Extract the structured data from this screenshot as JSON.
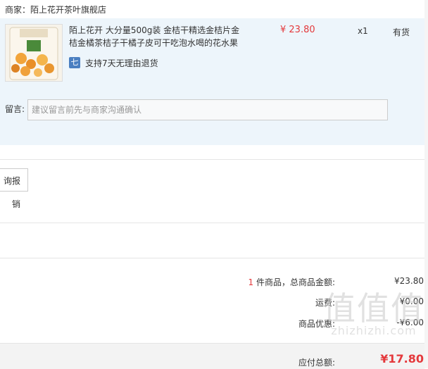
{
  "seller": {
    "label": "商家：陌上花开茶叶旗舰店"
  },
  "item": {
    "title": "陌上花开 大分量500g装 金桔干精选金桔片金桔金橘茶桔子干橘子皮可干吃泡水喝的花水果",
    "price": "¥ 23.80",
    "quantity": "x1",
    "stock": "有货",
    "return_policy": "支持7天无理由退货",
    "return_icon": "return-badge-icon"
  },
  "message": {
    "label": "留言:",
    "placeholder": "建议留言前先与商家沟通确认"
  },
  "invoice": {
    "button_label": "询报销"
  },
  "summary": {
    "count": "1",
    "count_text": " 件商品，总商品金额:",
    "goods_total": "¥23.80",
    "shipping_label": "运费:",
    "shipping_value": "¥0.00",
    "discount_label": "商品优惠:",
    "discount_value": "-¥6.00"
  },
  "total": {
    "label": "应付总额:",
    "value": "¥17.80"
  },
  "watermark": {
    "glyphs": "值值值",
    "text": "zhizhizhi.com"
  },
  "colors": {
    "price_red": "#e4393c",
    "panel_bg": "#edf5fb",
    "icon_blue": "#4a7fc1"
  }
}
